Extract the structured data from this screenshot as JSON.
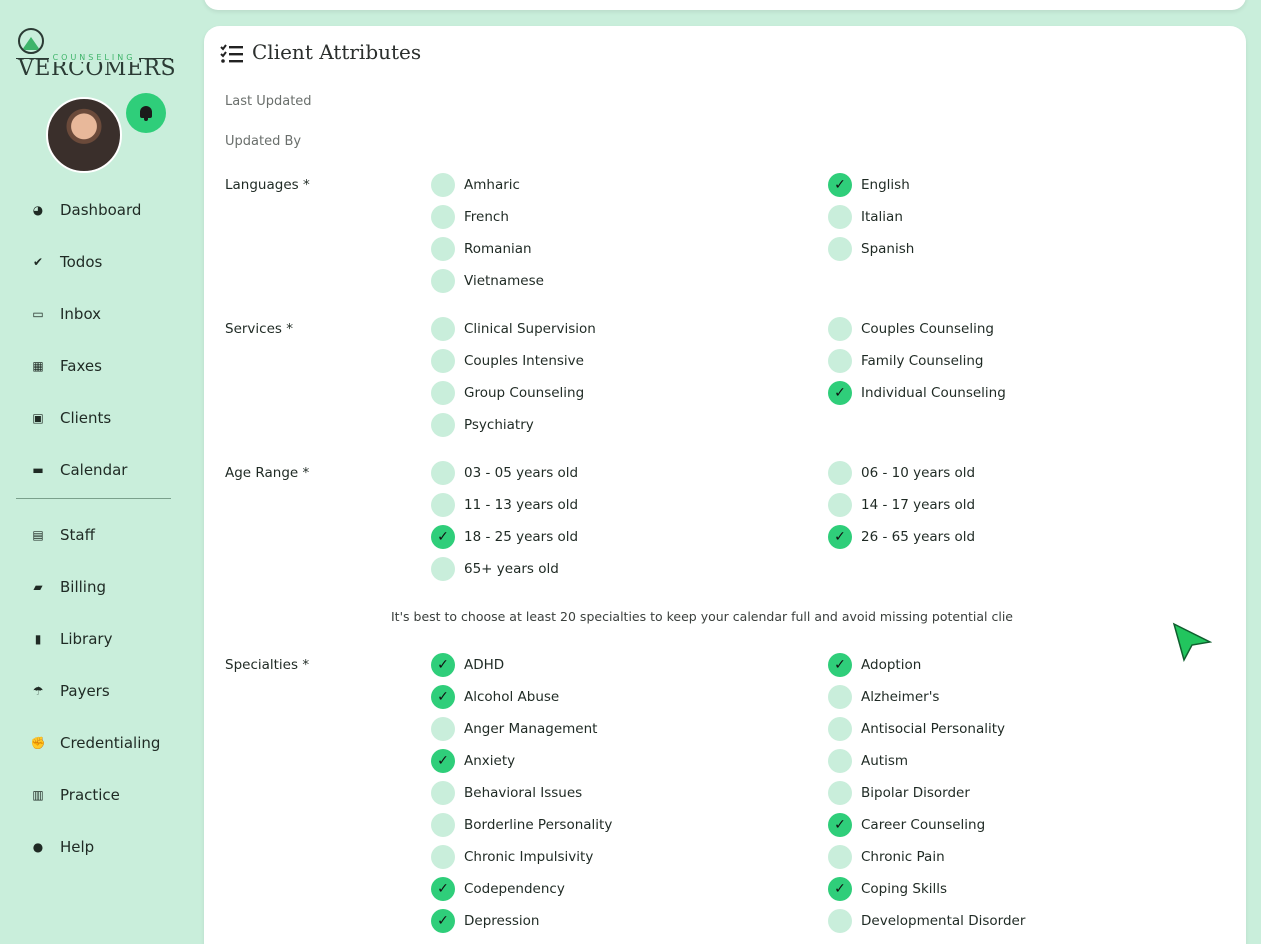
{
  "brand": {
    "name": "VERCOMERS",
    "sub": "COUNSELING"
  },
  "nav": [
    {
      "label": "Dashboard",
      "icon": "dashboard-icon",
      "glyph": "◕"
    },
    {
      "label": "Todos",
      "icon": "todos-icon",
      "glyph": "✔"
    },
    {
      "label": "Inbox",
      "icon": "inbox-icon",
      "glyph": "▭"
    },
    {
      "label": "Faxes",
      "icon": "fax-icon",
      "glyph": "▦"
    },
    {
      "label": "Clients",
      "icon": "clients-icon",
      "glyph": "▣"
    },
    {
      "label": "Calendar",
      "icon": "calendar-icon",
      "glyph": "▬"
    },
    {
      "label": "Staff",
      "icon": "staff-icon",
      "glyph": "▤"
    },
    {
      "label": "Billing",
      "icon": "billing-icon",
      "glyph": "▰"
    },
    {
      "label": "Library",
      "icon": "library-icon",
      "glyph": "▮"
    },
    {
      "label": "Payers",
      "icon": "payers-icon",
      "glyph": "☂"
    },
    {
      "label": "Credentialing",
      "icon": "handshake-icon",
      "glyph": "✊"
    },
    {
      "label": "Practice",
      "icon": "building-icon",
      "glyph": "▥"
    },
    {
      "label": "Help",
      "icon": "help-icon",
      "glyph": "●"
    }
  ],
  "card": {
    "title": "Client Attributes",
    "last_updated_label": "Last Updated",
    "updated_by_label": "Updated By",
    "hint": "It's best to choose at least 20 specialties to keep your calendar full and avoid missing potential clie"
  },
  "sections": {
    "languages": {
      "label": "Languages *",
      "options": [
        {
          "label": "Amharic",
          "checked": false
        },
        {
          "label": "English",
          "checked": true
        },
        {
          "label": "French",
          "checked": false
        },
        {
          "label": "Italian",
          "checked": false
        },
        {
          "label": "Romanian",
          "checked": false
        },
        {
          "label": "Spanish",
          "checked": false
        },
        {
          "label": "Vietnamese",
          "checked": false
        }
      ]
    },
    "services": {
      "label": "Services *",
      "options": [
        {
          "label": "Clinical Supervision",
          "checked": false
        },
        {
          "label": "Couples Counseling",
          "checked": false
        },
        {
          "label": "Couples Intensive",
          "checked": false
        },
        {
          "label": "Family Counseling",
          "checked": false
        },
        {
          "label": "Group Counseling",
          "checked": false
        },
        {
          "label": "Individual Counseling",
          "checked": true
        },
        {
          "label": "Psychiatry",
          "checked": false
        }
      ]
    },
    "age_range": {
      "label": "Age Range *",
      "options": [
        {
          "label": "03 - 05 years old",
          "checked": false
        },
        {
          "label": "06 - 10 years old",
          "checked": false
        },
        {
          "label": "11 - 13 years old",
          "checked": false
        },
        {
          "label": "14 - 17 years old",
          "checked": false
        },
        {
          "label": "18 - 25 years old",
          "checked": true
        },
        {
          "label": "26 - 65 years old",
          "checked": true
        },
        {
          "label": "65+ years old",
          "checked": false
        }
      ]
    },
    "specialties": {
      "label": "Specialties *",
      "options": [
        {
          "label": "ADHD",
          "checked": true
        },
        {
          "label": "Adoption",
          "checked": true
        },
        {
          "label": "Alcohol Abuse",
          "checked": true
        },
        {
          "label": "Alzheimer's",
          "checked": false
        },
        {
          "label": "Anger Management",
          "checked": false
        },
        {
          "label": "Antisocial Personality",
          "checked": false
        },
        {
          "label": "Anxiety",
          "checked": true
        },
        {
          "label": "Autism",
          "checked": false
        },
        {
          "label": "Behavioral Issues",
          "checked": false
        },
        {
          "label": "Bipolar Disorder",
          "checked": false
        },
        {
          "label": "Borderline Personality",
          "checked": false
        },
        {
          "label": "Career Counseling",
          "checked": true
        },
        {
          "label": "Chronic Impulsivity",
          "checked": false
        },
        {
          "label": "Chronic Pain",
          "checked": false
        },
        {
          "label": "Codependency",
          "checked": true
        },
        {
          "label": "Coping Skills",
          "checked": true
        },
        {
          "label": "Depression",
          "checked": true
        },
        {
          "label": "Developmental Disorder",
          "checked": false
        }
      ]
    }
  },
  "colors": {
    "accent": "#2fce7a",
    "background": "#c9eedb",
    "unchecked": "#c9eedb"
  }
}
